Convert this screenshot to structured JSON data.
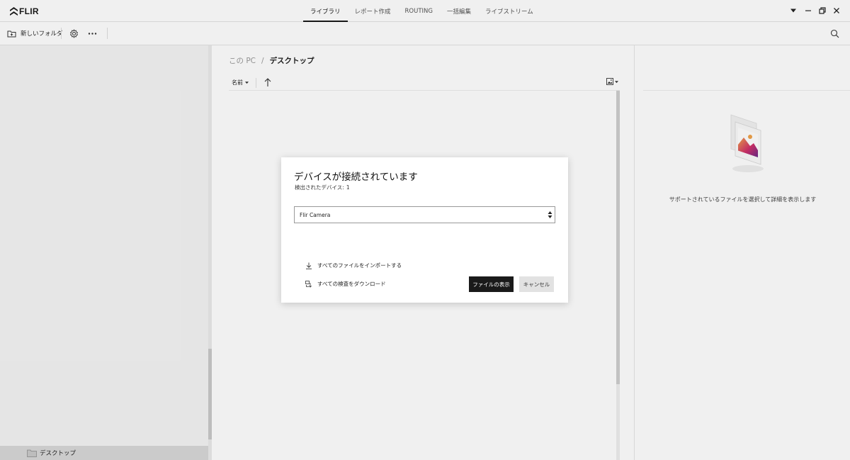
{
  "app": {
    "logo_text": "FLIR",
    "logo_icon": "flir-chevron-icon"
  },
  "tabs": [
    {
      "label": "ライブラリ",
      "active": true
    },
    {
      "label": "レポート作成",
      "active": false
    },
    {
      "label": "ROUTING",
      "active": false
    },
    {
      "label": "一括編集",
      "active": false
    },
    {
      "label": "ライブストリーム",
      "active": false
    }
  ],
  "window_controls": [
    "dropdown-icon",
    "minimize-icon",
    "restore-icon",
    "close-icon"
  ],
  "toolbar": {
    "new_folder_label": "新しいフォルダ",
    "icons": [
      "new-folder-icon",
      "settings-gear-icon",
      "more-options-icon",
      "search-icon"
    ]
  },
  "left_panel": {
    "tree_items": [
      {
        "label": "デスクトップ",
        "icon": "folder-icon",
        "selected": true
      }
    ]
  },
  "center_panel": {
    "breadcrumb": {
      "root": "この PC",
      "separator": "/",
      "current": "デスクトップ"
    },
    "sort": {
      "label": "名前",
      "direction": "ascending"
    }
  },
  "right_panel": {
    "hint": "サポートされているファイルを選択して詳細を表示します"
  },
  "dialog": {
    "title": "デバイスが接続されています",
    "subtitle_label": "検出されたデバイス:",
    "subtitle_count": "1",
    "device_select": {
      "value": "Flir Camera",
      "options": [
        "Flir Camera"
      ]
    },
    "actions": [
      {
        "label": "すべてのファイルをインポートする",
        "icon": "download-icon"
      },
      {
        "label": "すべての検査をダウンロード",
        "icon": "inspection-download-icon"
      }
    ],
    "primary_button": "ファイルの表示",
    "secondary_button": "キャンセル"
  },
  "colors": {
    "primary_button_bg": "#1a1a1a",
    "secondary_button_bg": "#e2e2e2",
    "overlay": "rgba(0,0,0,0.06)",
    "illustration_gradient": [
      "#f0a24a",
      "#d0306a",
      "#6a2a8a"
    ]
  }
}
